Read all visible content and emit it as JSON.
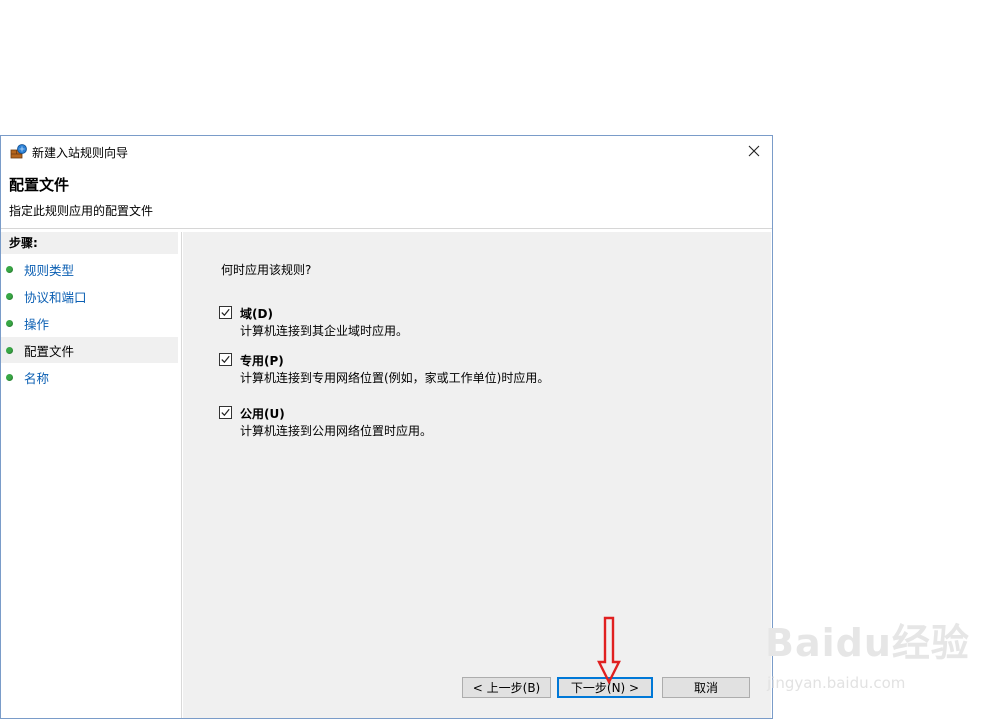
{
  "window": {
    "title": "新建入站规则向导",
    "close_label": "✕"
  },
  "header": {
    "title": "配置文件",
    "subtitle": "指定此规则应用的配置文件"
  },
  "steps": {
    "title": "步骤:",
    "items": [
      {
        "label": "规则类型"
      },
      {
        "label": "协议和端口"
      },
      {
        "label": "操作"
      },
      {
        "label": "配置文件"
      },
      {
        "label": "名称"
      }
    ],
    "selected_index": 3
  },
  "content": {
    "question": "何时应用该规则?",
    "options": [
      {
        "label": "域(D)",
        "description": "计算机连接到其企业域时应用。",
        "checked": true
      },
      {
        "label": "专用(P)",
        "description": "计算机连接到专用网络位置(例如，家或工作单位)时应用。",
        "checked": true
      },
      {
        "label": "公用(U)",
        "description": "计算机连接到公用网络位置时应用。",
        "checked": true
      }
    ]
  },
  "buttons": {
    "back": "< 上一步(B)",
    "next": "下一步(N) >",
    "cancel": "取消"
  },
  "watermark": {
    "logo": "Baidu经验",
    "url": "jingyan.baidu.com"
  },
  "colors": {
    "link": "#0b5fb3",
    "step_dot": "#39a845",
    "content_bg": "#f0f0f0",
    "primary_border": "#0078d7",
    "annotation_arrow": "#e02020"
  },
  "icons": {
    "app": "firewall-wizard-icon",
    "close": "close-icon",
    "step": "green-dot-icon",
    "checkbox": "check-icon",
    "annotation": "red-down-arrow"
  }
}
